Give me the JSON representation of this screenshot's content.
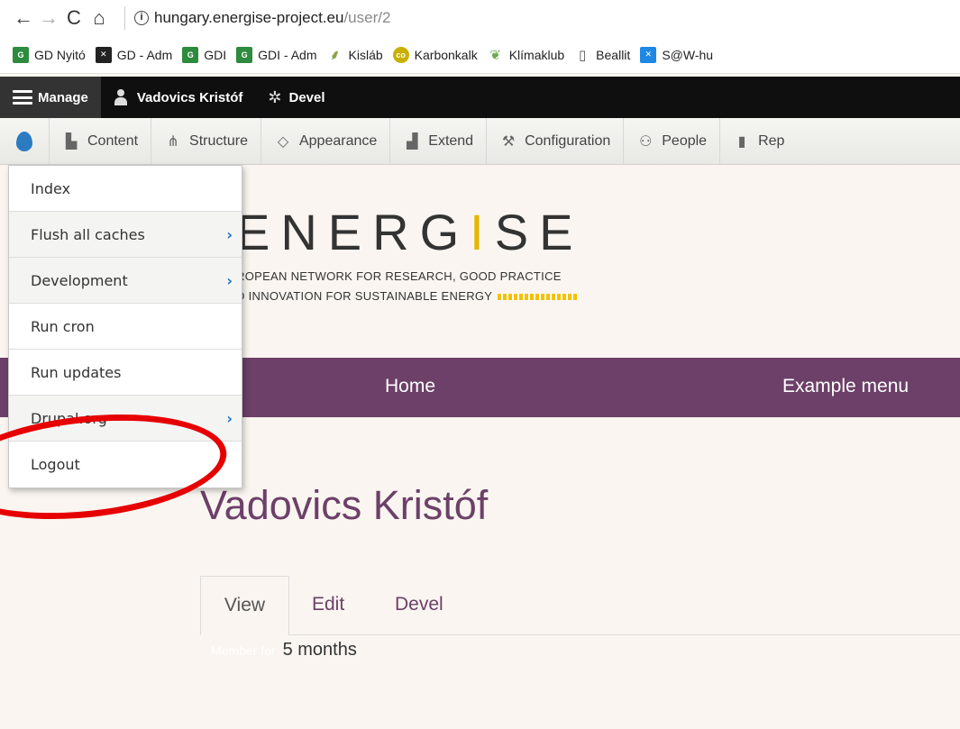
{
  "browser": {
    "url_host": "hungary.energise-project.eu",
    "url_path": "/user/2",
    "bookmarks": [
      {
        "label": "GD Nyitó",
        "color": "#2d8a3e"
      },
      {
        "label": "GD - Adm",
        "color": "#222"
      },
      {
        "label": "GDI",
        "color": "#2d8a3e"
      },
      {
        "label": "GDI - Adm",
        "color": "#2d8a3e"
      },
      {
        "label": "Kisláb",
        "color": "#8aa24a"
      },
      {
        "label": "Karbonkalk",
        "color": "#c9b000"
      },
      {
        "label": "Klímaklub",
        "color": "#6aa84f"
      },
      {
        "label": "Beallit",
        "color": "#888"
      },
      {
        "label": "S@W-hu",
        "color": "#1e88e5"
      }
    ]
  },
  "toolbar": {
    "manage": "Manage",
    "user": "Vadovics Kristóf",
    "devel": "Devel",
    "tray": [
      {
        "label": "Content",
        "icon": "file-icon"
      },
      {
        "label": "Structure",
        "icon": "sitemap-icon"
      },
      {
        "label": "Appearance",
        "icon": "brush-icon"
      },
      {
        "label": "Extend",
        "icon": "puzzle-icon"
      },
      {
        "label": "Configuration",
        "icon": "wrench-icon"
      },
      {
        "label": "People",
        "icon": "people-icon"
      },
      {
        "label": "Rep",
        "icon": "bar-chart-icon"
      }
    ]
  },
  "dropdown": {
    "items": [
      {
        "label": "Index",
        "has_sub": false
      },
      {
        "label": "Flush all caches",
        "has_sub": true
      },
      {
        "label": "Development",
        "has_sub": true
      },
      {
        "label": "Run cron",
        "has_sub": false
      },
      {
        "label": "Run updates",
        "has_sub": false
      },
      {
        "label": "Drupal.org",
        "has_sub": true
      },
      {
        "label": "Logout",
        "has_sub": false
      }
    ]
  },
  "site": {
    "logo_text": "ENERGISE",
    "tagline_1": "ROPEAN NETWORK FOR RESEARCH, GOOD PRACTICE",
    "tagline_2": "D INNOVATION FOR SUSTAINABLE ENERGY",
    "nav": {
      "home": "Home",
      "example": "Example menu"
    }
  },
  "page": {
    "title": "Vadovics Kristóf",
    "tabs": {
      "view": "View",
      "edit": "Edit",
      "devel": "Devel"
    },
    "member_label": "Member for",
    "member_value": "5 months"
  },
  "colors": {
    "accent": "#6c4068",
    "annotation": "#e60000",
    "link_blue": "#1d6fc6"
  }
}
